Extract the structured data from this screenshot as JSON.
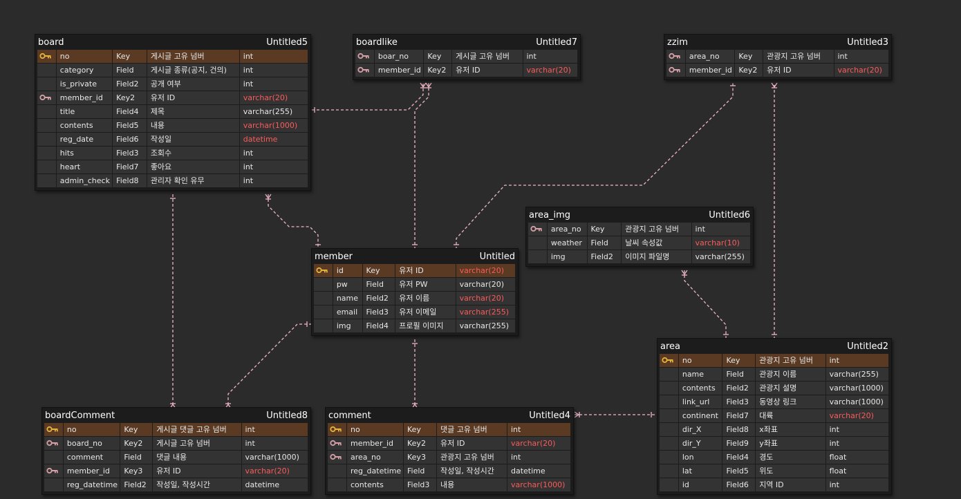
{
  "colors": {
    "background": "#2b2b2b",
    "table": "#1c1c1c",
    "cell": "#333333",
    "highlight_row": "#5a3a22",
    "primary_key": "#e8b33a",
    "foreign_key": "#d6a1a8",
    "relation_line": "#f0b8c8",
    "red_type": "#ff5a5a"
  },
  "tables": [
    {
      "id": "board",
      "name": "board",
      "db": "Untitled5",
      "rows": [
        {
          "key": "primary",
          "name": "no",
          "kind": "Key",
          "comment": "게시글 고유 넘버",
          "type": "int",
          "red": false,
          "hl": true
        },
        {
          "key": "",
          "name": "category",
          "kind": "Field",
          "comment": "게시글 종류(공지, 건의)",
          "type": "int",
          "red": false,
          "hl": false
        },
        {
          "key": "",
          "name": "is_private",
          "kind": "Field2",
          "comment": "공개 여부",
          "type": "int",
          "red": false,
          "hl": false
        },
        {
          "key": "foreign",
          "name": "member_id",
          "kind": "Key2",
          "comment": "유저 ID",
          "type": "varchar(20)",
          "red": true,
          "hl": false
        },
        {
          "key": "",
          "name": "title",
          "kind": "Field4",
          "comment": "제목",
          "type": "varchar(255)",
          "red": false,
          "hl": false
        },
        {
          "key": "",
          "name": "contents",
          "kind": "Field5",
          "comment": "내용",
          "type": "varchar(1000)",
          "red": true,
          "hl": false
        },
        {
          "key": "",
          "name": "reg_date",
          "kind": "Field6",
          "comment": "작성일",
          "type": "datetime",
          "red": true,
          "hl": false
        },
        {
          "key": "",
          "name": "hits",
          "kind": "Field3",
          "comment": "조회수",
          "type": "int",
          "red": false,
          "hl": false
        },
        {
          "key": "",
          "name": "heart",
          "kind": "Field7",
          "comment": "좋아요",
          "type": "int",
          "red": false,
          "hl": false
        },
        {
          "key": "",
          "name": "admin_check",
          "kind": "Field8",
          "comment": "관리자 확인 유무",
          "type": "int",
          "red": false,
          "hl": false
        }
      ]
    },
    {
      "id": "boardlike",
      "name": "boardlike",
      "db": "Untitled7",
      "rows": [
        {
          "key": "foreign",
          "name": "boar_no",
          "kind": "Key",
          "comment": "게시글 고유 넘버",
          "type": "int",
          "red": false,
          "hl": false
        },
        {
          "key": "foreign",
          "name": "member_id",
          "kind": "Key2",
          "comment": "유저 ID",
          "type": "varchar(20)",
          "red": true,
          "hl": false
        }
      ]
    },
    {
      "id": "zzim",
      "name": "zzim",
      "db": "Untitled3",
      "rows": [
        {
          "key": "foreign",
          "name": "area_no",
          "kind": "Key",
          "comment": "관광지 고유 넘버",
          "type": "int",
          "red": false,
          "hl": false
        },
        {
          "key": "foreign",
          "name": "member_id",
          "kind": "Key2",
          "comment": "유저 ID",
          "type": "varchar(20)",
          "red": true,
          "hl": false
        }
      ]
    },
    {
      "id": "area_img",
      "name": "area_img",
      "db": "Untitled6",
      "rows": [
        {
          "key": "foreign",
          "name": "area_no",
          "kind": "Key",
          "comment": "관광지 고유 넘버",
          "type": "int",
          "red": false,
          "hl": false
        },
        {
          "key": "",
          "name": "weather",
          "kind": "Field",
          "comment": "날씨 속성값",
          "type": "varchar(10)",
          "red": true,
          "hl": false
        },
        {
          "key": "",
          "name": "img",
          "kind": "Field2",
          "comment": "이미지 파일명",
          "type": "varchar(255)",
          "red": false,
          "hl": false
        }
      ]
    },
    {
      "id": "member",
      "name": "member",
      "db": "Untitled",
      "rows": [
        {
          "key": "primary",
          "name": "id",
          "kind": "Key",
          "comment": "유저 ID",
          "type": "varchar(20)",
          "red": true,
          "hl": true
        },
        {
          "key": "",
          "name": "pw",
          "kind": "Field",
          "comment": "유저 PW",
          "type": "varchar(20)",
          "red": false,
          "hl": false
        },
        {
          "key": "",
          "name": "name",
          "kind": "Field2",
          "comment": "유저 이름",
          "type": "varchar(20)",
          "red": true,
          "hl": false
        },
        {
          "key": "",
          "name": "email",
          "kind": "Field3",
          "comment": "유저 이메일",
          "type": "varchar(255)",
          "red": true,
          "hl": false
        },
        {
          "key": "",
          "name": "img",
          "kind": "Field4",
          "comment": "프로필 이미지",
          "type": "varchar(255)",
          "red": false,
          "hl": false
        }
      ]
    },
    {
      "id": "area",
      "name": "area",
      "db": "Untitled2",
      "rows": [
        {
          "key": "primary",
          "name": "no",
          "kind": "Key",
          "comment": "관광지 고유 넘버",
          "type": "int",
          "red": false,
          "hl": true
        },
        {
          "key": "",
          "name": "name",
          "kind": "Field",
          "comment": "관광지 이름",
          "type": "varchar(255)",
          "red": false,
          "hl": false
        },
        {
          "key": "",
          "name": "contents",
          "kind": "Field2",
          "comment": "관광지 설명",
          "type": "varchar(1000)",
          "red": false,
          "hl": false
        },
        {
          "key": "",
          "name": "link_url",
          "kind": "Field3",
          "comment": "동영상 링크",
          "type": "varchar(1000)",
          "red": false,
          "hl": false
        },
        {
          "key": "",
          "name": "continent",
          "kind": "Field7",
          "comment": "대륙",
          "type": "varchar(20)",
          "red": true,
          "hl": false
        },
        {
          "key": "",
          "name": "dir_X",
          "kind": "Field8",
          "comment": "x좌표",
          "type": "int",
          "red": false,
          "hl": false
        },
        {
          "key": "",
          "name": "dir_Y",
          "kind": "Field9",
          "comment": "y좌표",
          "type": "int",
          "red": false,
          "hl": false
        },
        {
          "key": "",
          "name": "lon",
          "kind": "Field4",
          "comment": "경도",
          "type": "float",
          "red": false,
          "hl": false
        },
        {
          "key": "",
          "name": "lat",
          "kind": "Field5",
          "comment": "위도",
          "type": "float",
          "red": false,
          "hl": false
        },
        {
          "key": "",
          "name": "id",
          "kind": "Field6",
          "comment": "지역 ID",
          "type": "int",
          "red": false,
          "hl": false
        }
      ]
    },
    {
      "id": "boardComment",
      "name": "boardComment",
      "db": "Untitled8",
      "rows": [
        {
          "key": "primary",
          "name": "no",
          "kind": "Key",
          "comment": "게시글 댓글 고유 넘버",
          "type": "int",
          "red": false,
          "hl": true
        },
        {
          "key": "foreign",
          "name": "board_no",
          "kind": "Key2",
          "comment": "게시글 고유 넘버",
          "type": "int",
          "red": false,
          "hl": false
        },
        {
          "key": "",
          "name": "comment",
          "kind": "Field",
          "comment": "댓글 내용",
          "type": "varchar(1000)",
          "red": false,
          "hl": false
        },
        {
          "key": "foreign",
          "name": "member_id",
          "kind": "Key3",
          "comment": "유저 ID",
          "type": "varchar(20)",
          "red": true,
          "hl": false
        },
        {
          "key": "",
          "name": "reg_datetime",
          "kind": "Field2",
          "comment": "작성일, 작성시간",
          "type": "datetime",
          "red": false,
          "hl": false
        }
      ]
    },
    {
      "id": "comment",
      "name": "comment",
      "db": "Untitled4",
      "rows": [
        {
          "key": "primary",
          "name": "no",
          "kind": "Key",
          "comment": "댓글 고유 넘버",
          "type": "int",
          "red": false,
          "hl": true
        },
        {
          "key": "foreign",
          "name": "member_id",
          "kind": "Key2",
          "comment": "유저 ID",
          "type": "varchar(20)",
          "red": true,
          "hl": false
        },
        {
          "key": "foreign",
          "name": "area_no",
          "kind": "Key3",
          "comment": "관광지 고유 넘버",
          "type": "int",
          "red": false,
          "hl": false
        },
        {
          "key": "",
          "name": "reg_datetime",
          "kind": "Field",
          "comment": "작성일, 작성시간",
          "type": "datetime",
          "red": false,
          "hl": false
        },
        {
          "key": "",
          "name": "contents",
          "kind": "Field3",
          "comment": "내용",
          "type": "varchar(1000)",
          "red": true,
          "hl": false
        }
      ]
    }
  ]
}
